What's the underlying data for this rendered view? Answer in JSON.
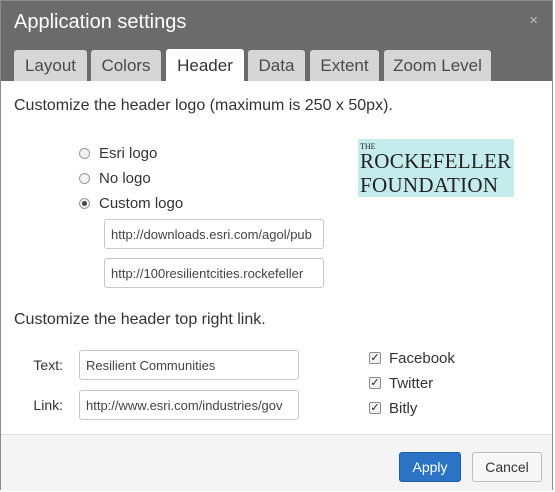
{
  "window": {
    "title": "Application settings",
    "close_glyph": "×"
  },
  "tabs": [
    {
      "label": "Layout",
      "active": false
    },
    {
      "label": "Colors",
      "active": false
    },
    {
      "label": "Header",
      "active": true
    },
    {
      "label": "Data",
      "active": false
    },
    {
      "label": "Extent",
      "active": false
    },
    {
      "label": "Zoom Level",
      "active": false
    }
  ],
  "header_logo": {
    "heading": "Customize the header logo (maximum is 250 x 50px).",
    "options": [
      {
        "label": "Esri logo",
        "checked": false
      },
      {
        "label": "No logo",
        "checked": false
      },
      {
        "label": "Custom logo",
        "checked": true
      }
    ],
    "logo_url": "http://downloads.esri.com/agol/pub",
    "link_url": "http://100resilientcities.rockefeller",
    "preview": {
      "line_small": "THE",
      "line1": "ROCKEFELLER",
      "line2": "FOUNDATION",
      "background": "#c5ecec"
    }
  },
  "top_right_link": {
    "heading": "Customize the header top right link.",
    "text_label": "Text:",
    "text_value": "Resilient Communities",
    "link_label": "Link:",
    "link_value": "http://www.esri.com/industries/gov",
    "social": [
      {
        "label": "Facebook",
        "checked": true
      },
      {
        "label": "Twitter",
        "checked": true
      },
      {
        "label": "Bitly",
        "checked": true
      }
    ]
  },
  "footer": {
    "apply_label": "Apply",
    "cancel_label": "Cancel"
  },
  "colors": {
    "titlebar": "#6b6b6b",
    "apply": "#2a73c5"
  }
}
